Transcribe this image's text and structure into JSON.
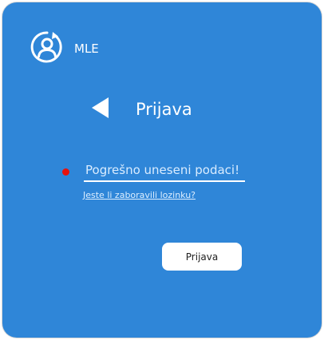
{
  "header": {
    "logo_icon": "user-refresh-icon",
    "app_name": "MLE"
  },
  "title_bar": {
    "back_icon": "back-triangle-icon",
    "title": "Prijava"
  },
  "form": {
    "error_indicator_color": "#e8120c",
    "field_value": "Pogrešno uneseni podaci!",
    "forgot_password": "Jeste li zaboravili lozinku?",
    "submit_label": "Prijava"
  },
  "colors": {
    "background": "#2f86d8",
    "foreground": "#ffffff"
  }
}
